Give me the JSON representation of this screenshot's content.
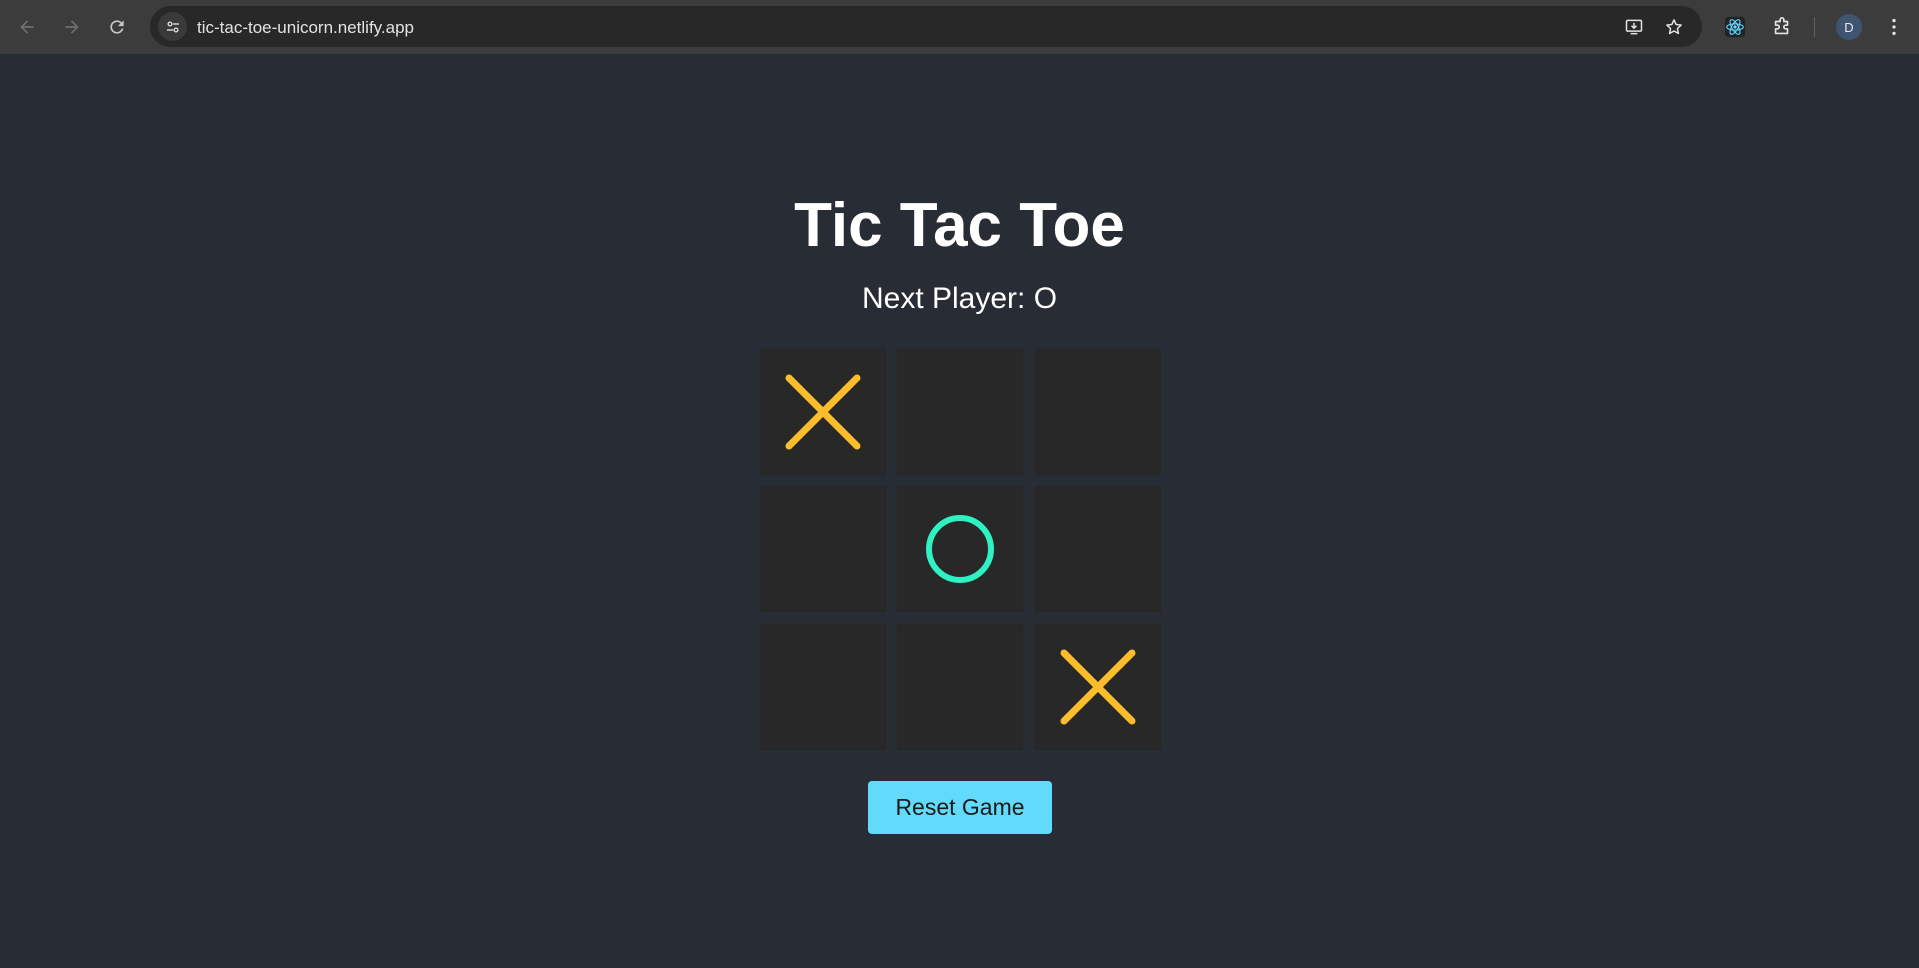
{
  "browser": {
    "url": "tic-tac-toe-unicorn.netlify.app",
    "avatar_initial": "D",
    "icons": [
      "back-arrow-icon",
      "forward-arrow-icon",
      "reload-icon",
      "site-info-icon",
      "install-app-icon",
      "bookmark-star-icon",
      "react-devtools-icon",
      "extensions-icon",
      "more-menu-icon"
    ]
  },
  "game": {
    "title": "Tic Tac Toe",
    "status": "Next Player: O",
    "board": [
      "X",
      "",
      "",
      "",
      "O",
      "",
      "",
      "",
      "X"
    ],
    "reset_label": "Reset Game"
  },
  "colors": {
    "page_bg": "#282c34",
    "cell_bg": "#282828",
    "x_color": "#fbbd2b",
    "o_color": "#2ef2c4",
    "button_bg": "#61dafb"
  }
}
